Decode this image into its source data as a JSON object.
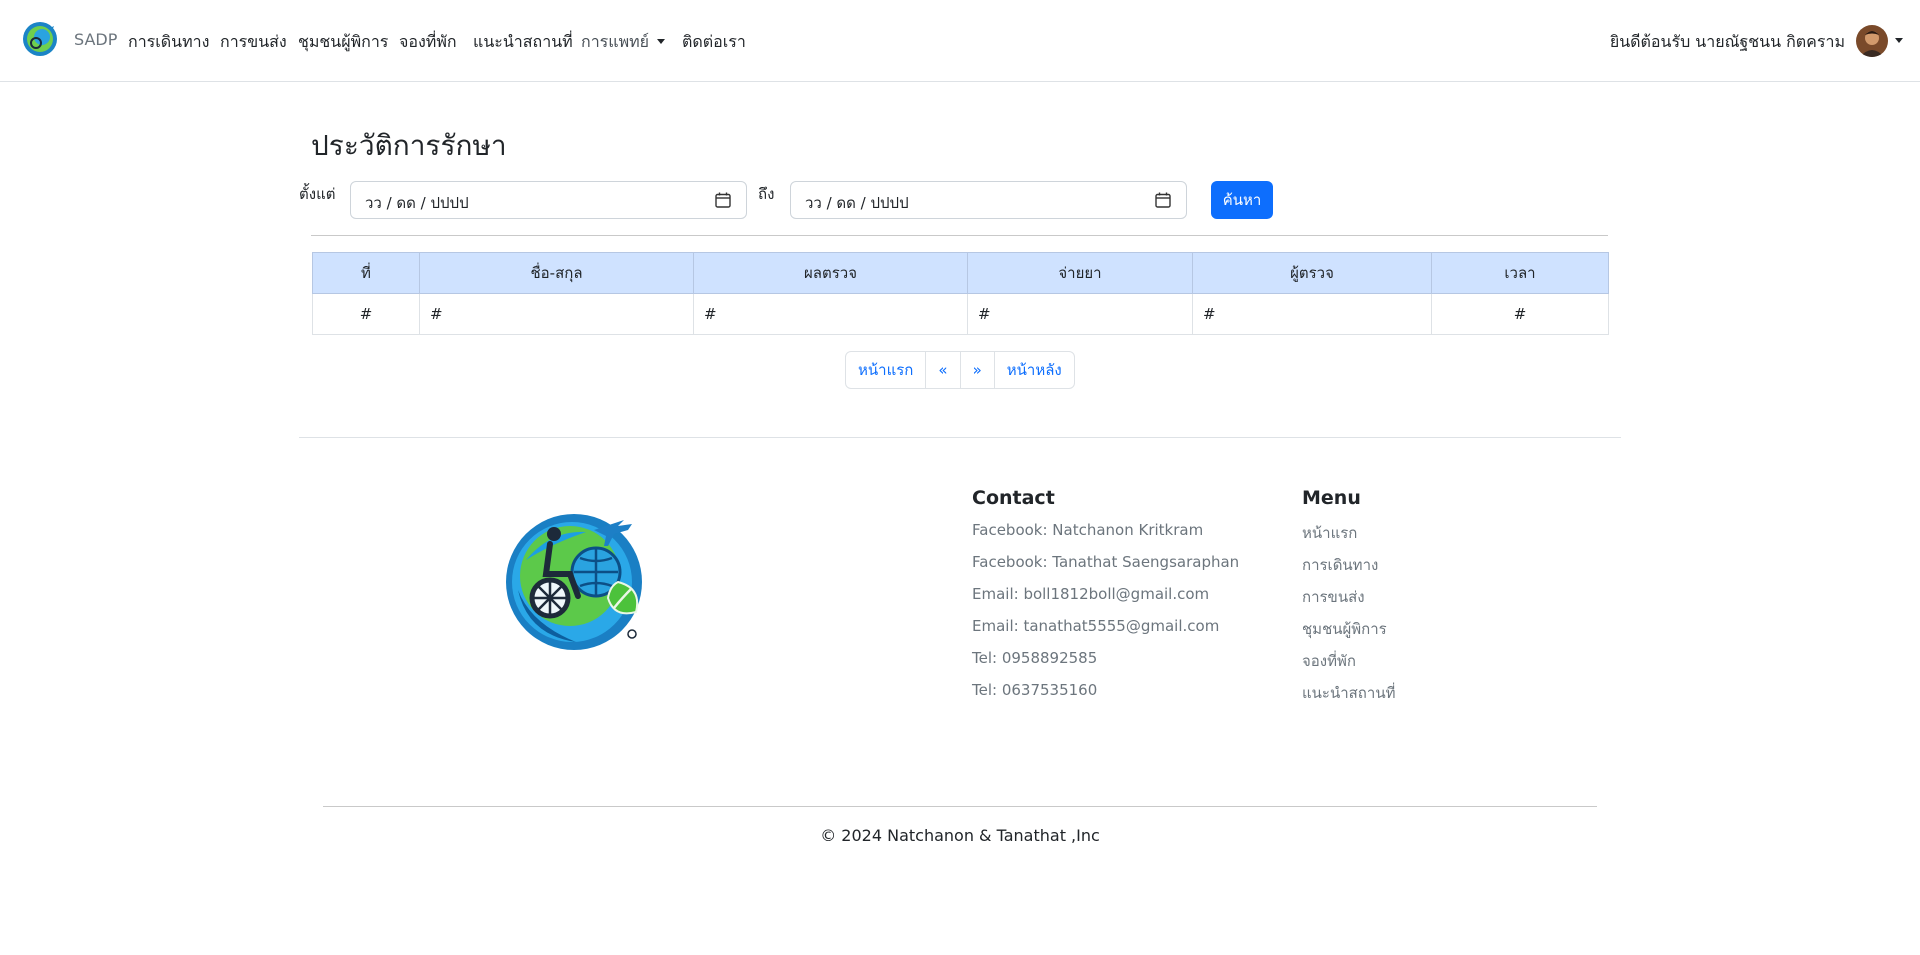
{
  "navbar": {
    "brand": "SADP",
    "links": [
      "การเดินทาง",
      "การขนส่ง",
      "ชุมชนผู้พิการ",
      "จองที่พัก",
      "แนะนำสถานที่"
    ],
    "dropdown_label": "การแพทย์",
    "contact_label": "ติดต่อเรา",
    "welcome": "ยินดีต้อนรับ  นายณัฐชนน กิตคราม"
  },
  "page": {
    "title": "ประวัติการรักษา",
    "from_label": "ตั้งแต่",
    "to_label": "ถึง",
    "from_value": "วว / ดด / ปปปป",
    "to_value": "วว / ดด / ปปปป",
    "search_label": "ค้นหา"
  },
  "table": {
    "headers": [
      "ที่",
      "ชื่อ-สกุล",
      "ผลตรวจ",
      "จ่ายยา",
      "ผู้ตรวจ",
      "เวลา"
    ],
    "rows": [
      [
        "#",
        "#",
        "#",
        "#",
        "#",
        "#"
      ]
    ]
  },
  "pagination": {
    "first": "หน้าแรก",
    "prev": "«",
    "next": "»",
    "last": "หน้าหลัง"
  },
  "footer": {
    "contact_title": "Contact",
    "contacts": [
      "Facebook: Natchanon Kritkram",
      "Facebook: Tanathat Saengsaraphan",
      "Email: boll1812boll@gmail.com",
      "Email: tanathat5555@gmail.com",
      "Tel: 0958892585",
      "Tel: 0637535160"
    ],
    "menu_title": "Menu",
    "menu": [
      "หน้าแรก",
      "การเดินทาง",
      "การขนส่ง",
      "ชุมชนผู้พิการ",
      "จองที่พัก",
      "แนะนำสถานที่"
    ],
    "copyright": "© 2024 Natchanon & Tanathat ,Inc"
  },
  "colors": {
    "primary": "#0d6efd",
    "table_header": "#cfe2ff",
    "muted": "#6c757d"
  },
  "icons": [
    "sadp-logo-icon",
    "calendar-icon",
    "user-avatar",
    "chevron-down-icon"
  ]
}
